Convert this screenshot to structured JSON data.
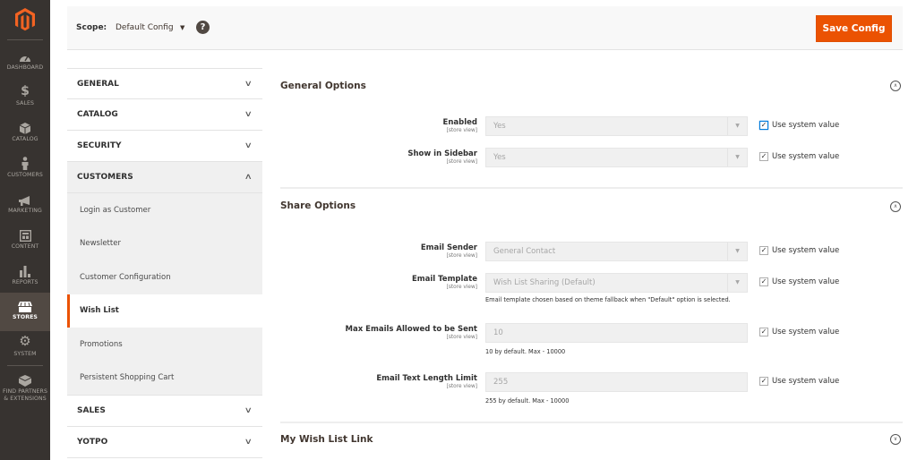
{
  "admin_nav": {
    "items": [
      {
        "label": "DASHBOARD",
        "icon": "dashboard-icon"
      },
      {
        "label": "SALES",
        "icon": "dollar-icon"
      },
      {
        "label": "CATALOG",
        "icon": "box-icon"
      },
      {
        "label": "CUSTOMERS",
        "icon": "person-icon"
      },
      {
        "label": "MARKETING",
        "icon": "megaphone-icon"
      },
      {
        "label": "CONTENT",
        "icon": "layout-icon"
      },
      {
        "label": "REPORTS",
        "icon": "bar-chart-icon"
      },
      {
        "label": "STORES",
        "icon": "store-icon",
        "active": true
      },
      {
        "label": "SYSTEM",
        "icon": "gear-icon"
      },
      {
        "label": "FIND PARTNERS & EXTENSIONS",
        "icon": "extensions-icon"
      }
    ]
  },
  "scope": {
    "label": "Scope:",
    "value": "Default Config",
    "help": "?"
  },
  "toolbar": {
    "save_label": "Save Config"
  },
  "config_tabs": {
    "general": "GENERAL",
    "catalog": "CATALOG",
    "security": "SECURITY",
    "customers": "CUSTOMERS",
    "customers_items": [
      "Login as Customer",
      "Newsletter",
      "Customer Configuration",
      "Wish List",
      "Promotions",
      "Persistent Shopping Cart"
    ],
    "active_item": "Wish List",
    "sales": "SALES",
    "yotpo": "YOTPO"
  },
  "sections": {
    "general_options": {
      "title": "General Options",
      "fields": [
        {
          "label": "Enabled",
          "scope": "[store view]",
          "value": "Yes",
          "use_system": "Use system value",
          "checked": true
        },
        {
          "label": "Show in Sidebar",
          "scope": "[store view]",
          "value": "Yes",
          "use_system": "Use system value",
          "checked": true
        }
      ]
    },
    "share_options": {
      "title": "Share Options",
      "fields": [
        {
          "label": "Email Sender",
          "scope": "[store view]",
          "value": "General Contact",
          "use_system": "Use system value",
          "checked": true
        },
        {
          "label": "Email Template",
          "scope": "[store view]",
          "value": "Wish List Sharing (Default)",
          "use_system": "Use system value",
          "checked": true,
          "note": "Email template chosen based on theme fallback when \"Default\" option is selected."
        },
        {
          "label": "Max Emails Allowed to be Sent",
          "scope": "[store view]",
          "value": "10",
          "use_system": "Use system value",
          "checked": true,
          "note": "10 by default. Max - 10000"
        },
        {
          "label": "Email Text Length Limit",
          "scope": "[store view]",
          "value": "255",
          "use_system": "Use system value",
          "checked": true,
          "note": "255 by default. Max - 10000"
        }
      ]
    },
    "my_wish_list_link": {
      "title": "My Wish List Link"
    }
  },
  "colors": {
    "accent": "#eb5202",
    "nav_bg": "#373330",
    "nav_active": "#514943"
  }
}
